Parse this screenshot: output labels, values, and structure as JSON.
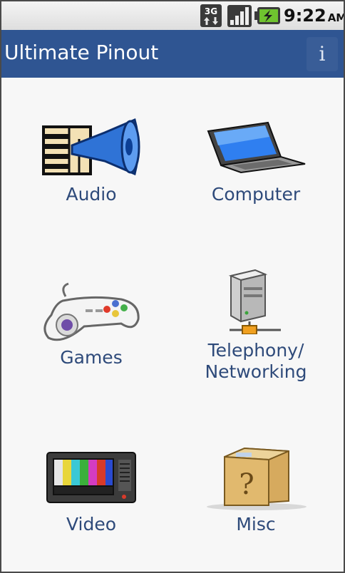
{
  "status_bar": {
    "network_label": "3G",
    "time": "9:22",
    "ampm": "AM",
    "icons": [
      "3g-data-icon",
      "signal-strength-icon",
      "battery-charging-icon"
    ]
  },
  "app": {
    "title": "Ultimate Pinout",
    "info_label": "i"
  },
  "categories": [
    {
      "label": "Audio",
      "icon": "audio-speaker-icon"
    },
    {
      "label": "Computer",
      "icon": "laptop-icon"
    },
    {
      "label": "Games",
      "icon": "gamepad-icon"
    },
    {
      "label": "Telephony/\nNetworking",
      "icon": "network-server-icon"
    },
    {
      "label": "Video",
      "icon": "television-icon"
    },
    {
      "label": "Misc",
      "icon": "question-box-icon"
    }
  ],
  "colors": {
    "title_bar": "#2f5592",
    "label_text": "#2e4a7a",
    "background": "#f7f7f7"
  }
}
